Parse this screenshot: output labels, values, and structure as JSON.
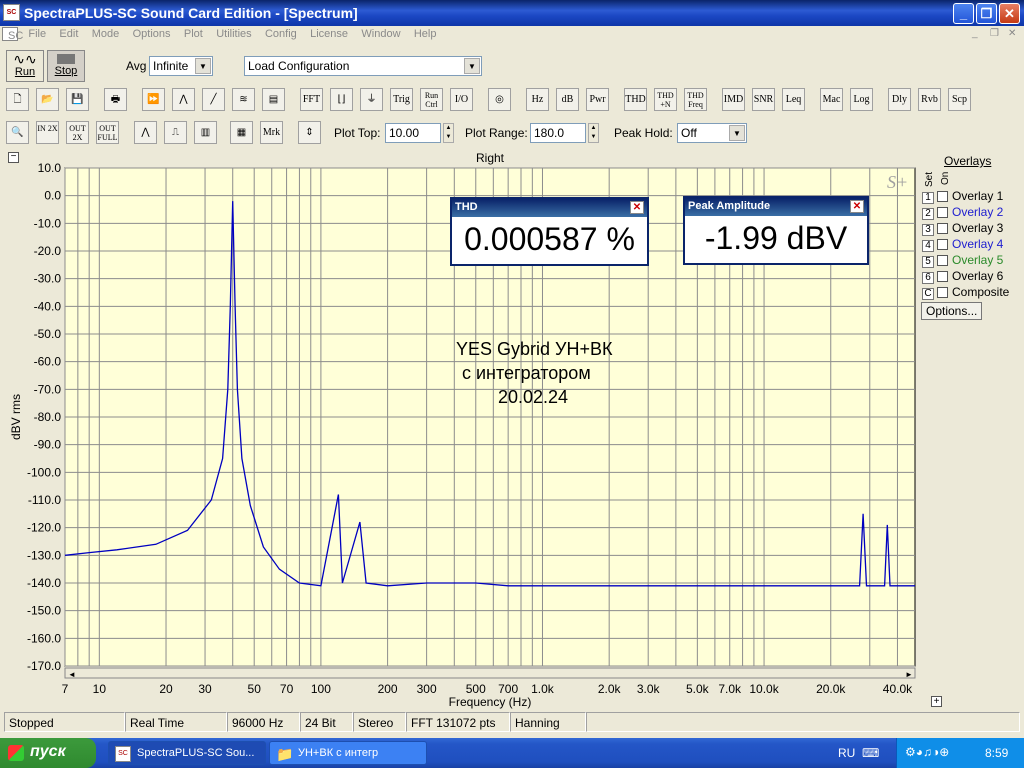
{
  "window": {
    "title": "SpectraPLUS-SC Sound Card Edition - [Spectrum]",
    "icon_label": "SC"
  },
  "menu": [
    "File",
    "Edit",
    "Mode",
    "Options",
    "Plot",
    "Utilities",
    "Config",
    "License",
    "Window",
    "Help"
  ],
  "toolbar1": {
    "run": "Run",
    "stop": "Stop",
    "avg_label": "Avg",
    "avg_value": "Infinite",
    "config_value": "Load Configuration"
  },
  "toolbar2_buttons": [
    "FFT",
    "Trig",
    "Run Ctrl",
    "I/O",
    "Hz",
    "dB",
    "Pwr",
    "THD",
    "THD +N",
    "THD Freq",
    "IMD",
    "SNR",
    "Leq",
    "Mac",
    "Log",
    "Dly",
    "Rvb",
    "Scp"
  ],
  "toolbar3": {
    "plot_top_label": "Plot Top:",
    "plot_top_value": "10.00",
    "plot_range_label": "Plot Range:",
    "plot_range_value": "180.0",
    "peak_hold_label": "Peak Hold:",
    "peak_hold_value": "Off",
    "mrk": "Mrk",
    "zoom_in": "IN 2X",
    "zoom_out": "OUT 2X",
    "zoom_full": "OUT FULL"
  },
  "plot": {
    "channel": "Right",
    "logo": "S+",
    "annotation": [
      "YES Gybrid  УН+ВК",
      "с интегратором",
      "20.02.24"
    ]
  },
  "thd_box": {
    "title": "THD",
    "value": "0.000587 %"
  },
  "peak_box": {
    "title": "Peak Amplitude",
    "value": "-1.99 dBV"
  },
  "overlays": {
    "title": "Overlays",
    "set": "Set",
    "on": "On",
    "items": [
      {
        "num": "1",
        "label": "Overlay 1",
        "color": "#000000"
      },
      {
        "num": "2",
        "label": "Overlay 2",
        "color": "#2020d0"
      },
      {
        "num": "3",
        "label": "Overlay 3",
        "color": "#000000"
      },
      {
        "num": "4",
        "label": "Overlay 4",
        "color": "#2020d0"
      },
      {
        "num": "5",
        "label": "Overlay 5",
        "color": "#2a8a2a"
      },
      {
        "num": "6",
        "label": "Overlay 6",
        "color": "#000000"
      },
      {
        "num": "C",
        "label": "Composite",
        "color": "#000000"
      }
    ],
    "options": "Options..."
  },
  "status": [
    "Stopped",
    "Real Time",
    "96000 Hz",
    "24 Bit",
    "Stereo",
    "FFT 131072 pts",
    "Hanning"
  ],
  "taskbar": {
    "start": "пуск",
    "tasks": [
      "SpectraPLUS-SC Sou...",
      "УН+ВК с интегр"
    ],
    "lang": "RU",
    "clock": "8:59"
  },
  "chart_data": {
    "type": "line",
    "title": "",
    "xlabel": "Frequency (Hz)",
    "ylabel": "dBV rms",
    "xscale": "log",
    "xlim": [
      7,
      48000
    ],
    "ylim": [
      -170,
      10
    ],
    "x_ticks": [
      "7",
      "10",
      "20",
      "30",
      "50",
      "70",
      "100",
      "200",
      "300",
      "500",
      "700",
      "1.0k",
      "2.0k",
      "3.0k",
      "5.0k",
      "7.0k",
      "10.0k",
      "20.0k",
      "40.0k"
    ],
    "y_ticks": [
      "10.0",
      "0.0",
      "-10.0",
      "-20.0",
      "-30.0",
      "-40.0",
      "-50.0",
      "-60.0",
      "-70.0",
      "-80.0",
      "-90.0",
      "-100.0",
      "-110.0",
      "-120.0",
      "-130.0",
      "-140.0",
      "-150.0",
      "-160.0",
      "-170.0"
    ],
    "grid": true,
    "line_color": "#0000c0",
    "series": [
      {
        "name": "Right",
        "points": [
          [
            7,
            -130
          ],
          [
            9,
            -129
          ],
          [
            12,
            -128
          ],
          [
            18,
            -126
          ],
          [
            25,
            -121
          ],
          [
            32,
            -110
          ],
          [
            36,
            -95
          ],
          [
            38,
            -70
          ],
          [
            39,
            -40
          ],
          [
            40,
            -2
          ],
          [
            41,
            -40
          ],
          [
            42,
            -70
          ],
          [
            44,
            -95
          ],
          [
            48,
            -112
          ],
          [
            55,
            -127
          ],
          [
            65,
            -135
          ],
          [
            80,
            -140
          ],
          [
            100,
            -141
          ],
          [
            120,
            -108
          ],
          [
            125,
            -140
          ],
          [
            150,
            -118
          ],
          [
            160,
            -140
          ],
          [
            200,
            -141
          ],
          [
            300,
            -140
          ],
          [
            500,
            -140
          ],
          [
            700,
            -141
          ],
          [
            1000,
            -141
          ],
          [
            2000,
            -141
          ],
          [
            5000,
            -141
          ],
          [
            10000,
            -141
          ],
          [
            20000,
            -141
          ],
          [
            27000,
            -141
          ],
          [
            28000,
            -115
          ],
          [
            29000,
            -141
          ],
          [
            35000,
            -141
          ],
          [
            36000,
            -119
          ],
          [
            37000,
            -141
          ],
          [
            40000,
            -141
          ],
          [
            45000,
            -141
          ],
          [
            48000,
            -141
          ]
        ]
      }
    ]
  }
}
